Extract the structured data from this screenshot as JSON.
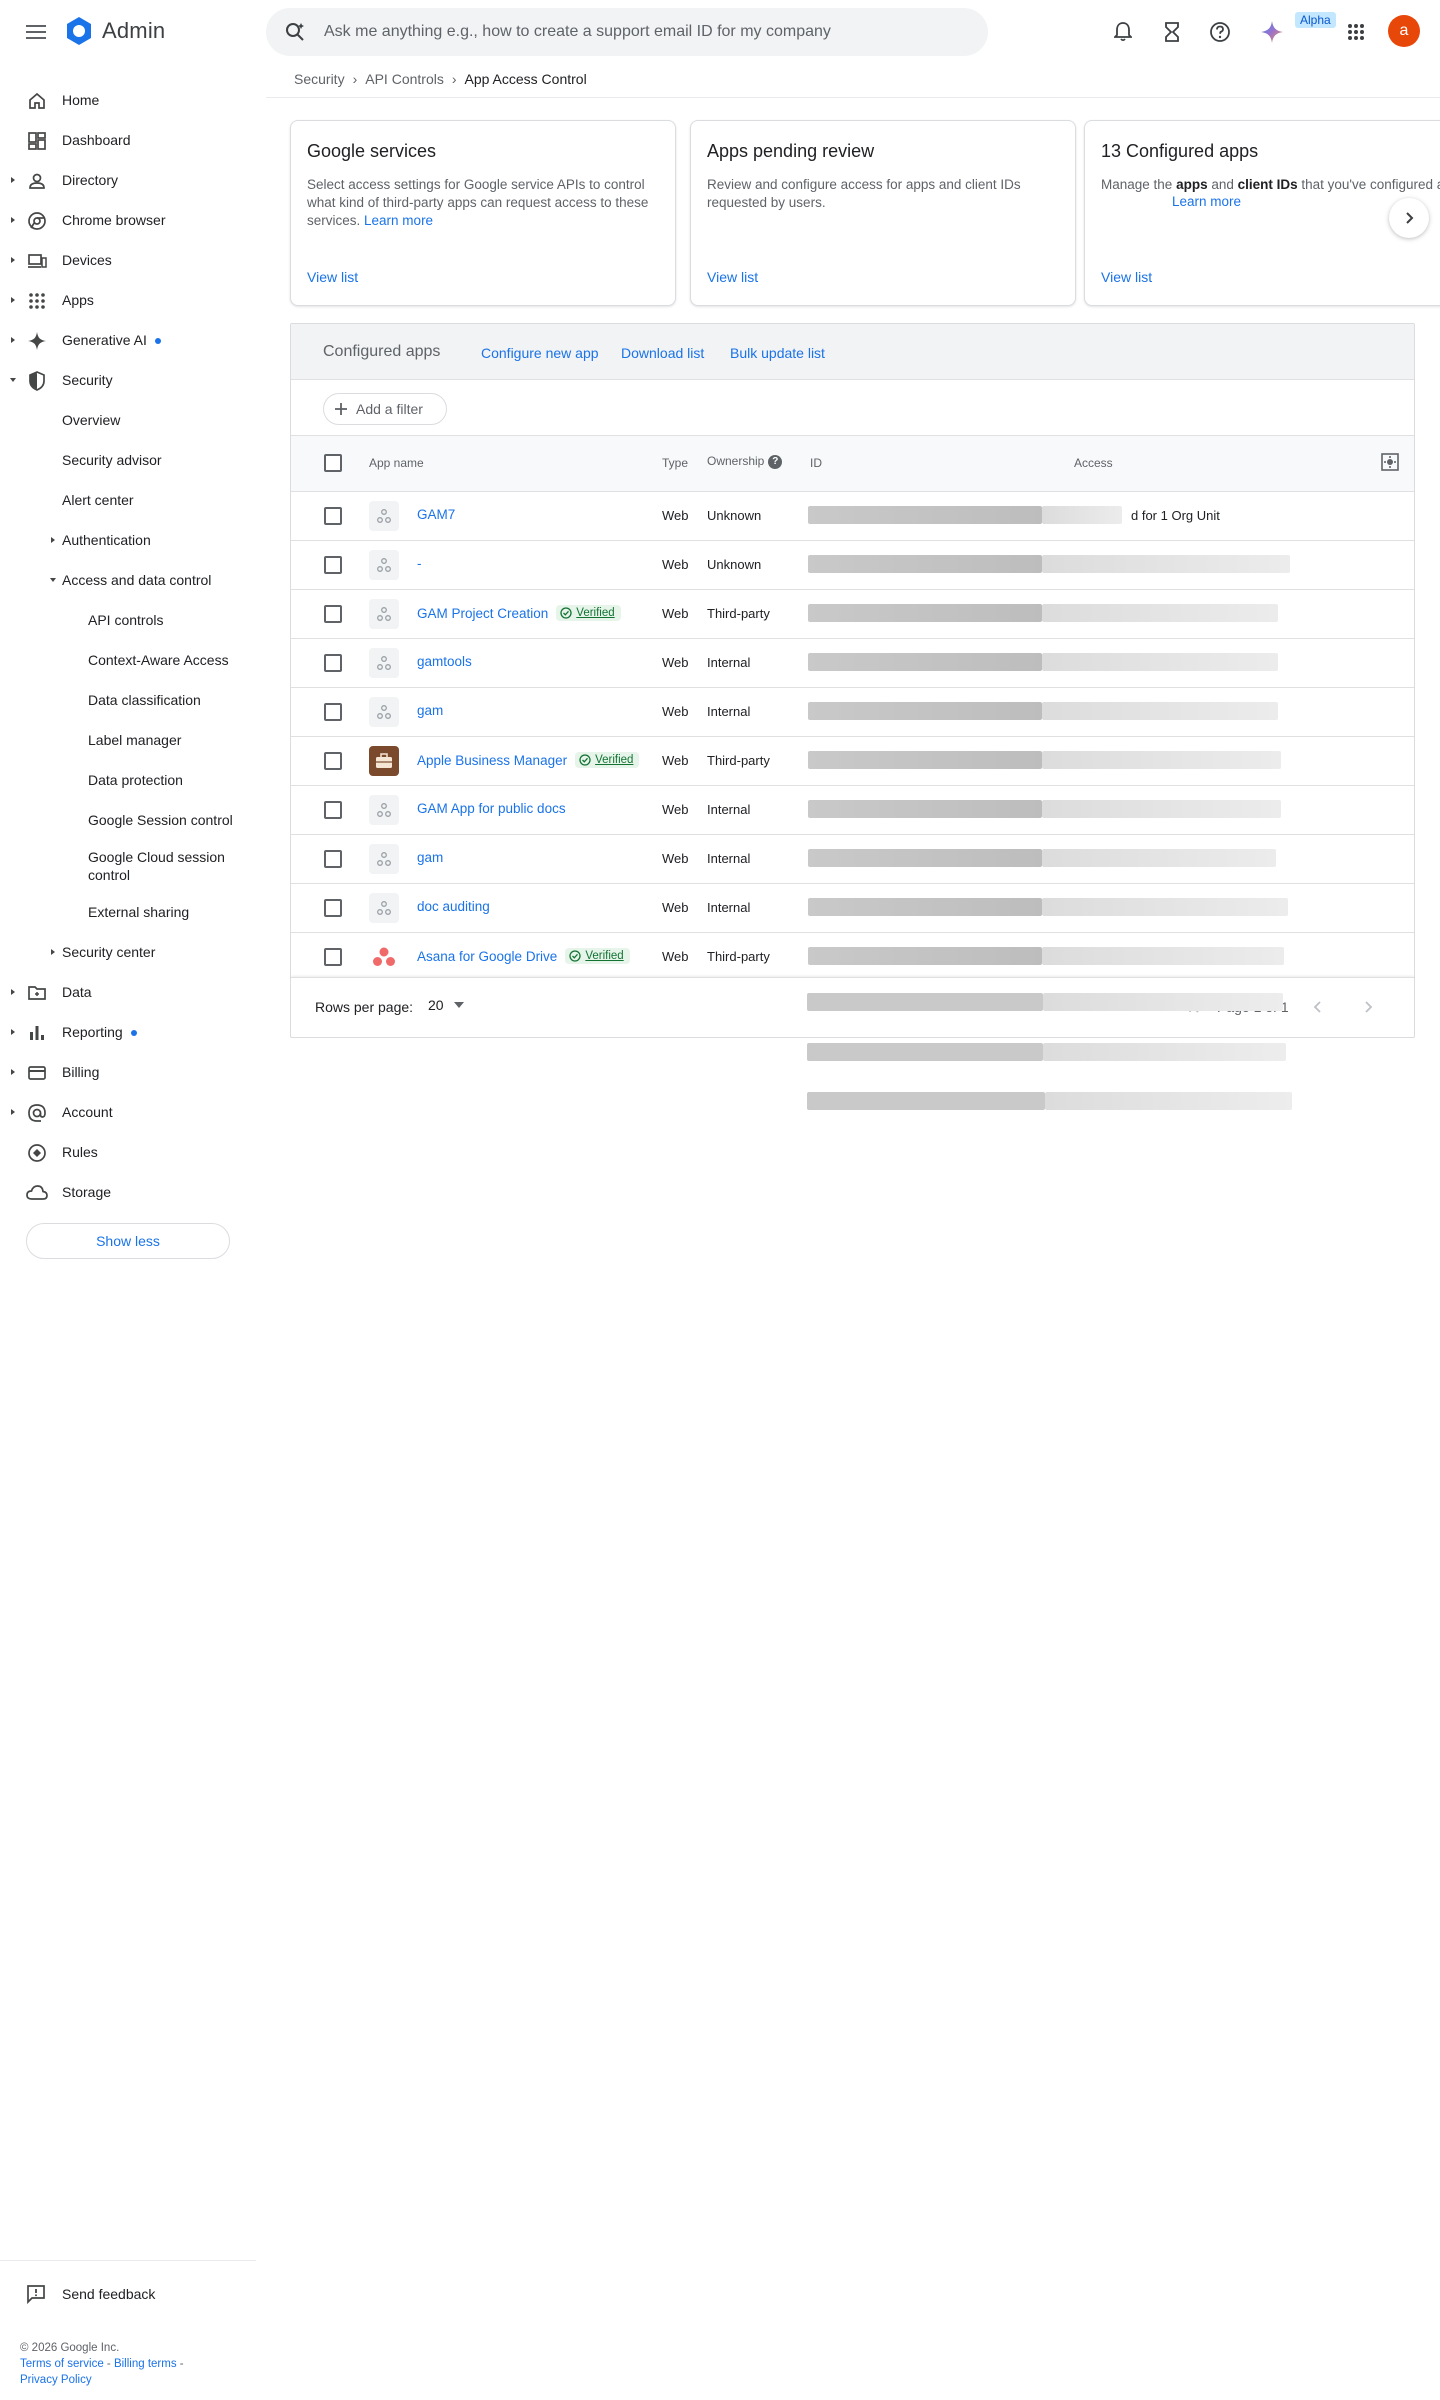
{
  "app": {
    "title": "Admin",
    "search_placeholder": "Ask me anything e.g., how to create a support email ID for my company",
    "alpha_badge": "Alpha",
    "avatar_initial": "a",
    "avatar_color": "#e8470a",
    "accent_color": "#1a73e8"
  },
  "breadcrumb": {
    "items": [
      "Security",
      "API Controls"
    ],
    "current": "App Access Control",
    "separator": "›"
  },
  "sidebar": {
    "items": [
      {
        "label": "Home",
        "icon": "home-icon"
      },
      {
        "label": "Dashboard",
        "icon": "dashboard-icon"
      },
      {
        "label": "Directory",
        "icon": "person-icon"
      },
      {
        "label": "Chrome browser",
        "icon": "chrome-icon"
      },
      {
        "label": "Devices",
        "icon": "devices-icon"
      },
      {
        "label": "Apps",
        "icon": "apps-grid-icon"
      },
      {
        "label": "Generative AI",
        "icon": "sparkle-icon"
      },
      {
        "label": "Security",
        "icon": "shield-icon"
      },
      {
        "label": "Overview"
      },
      {
        "label": "Security advisor"
      },
      {
        "label": "Alert center"
      },
      {
        "label": "Authentication"
      },
      {
        "label": "Access and data control"
      },
      {
        "label": "API controls"
      },
      {
        "label": "Context-Aware Access"
      },
      {
        "label": "Data classification"
      },
      {
        "label": "Label manager"
      },
      {
        "label": "Data protection"
      },
      {
        "label": "Google Session control"
      },
      {
        "label": "Google Cloud session control"
      },
      {
        "label": "External sharing"
      },
      {
        "label": "Security center"
      },
      {
        "label": "Data",
        "icon": "folder-icon"
      },
      {
        "label": "Reporting",
        "icon": "bar-chart-icon"
      },
      {
        "label": "Billing",
        "icon": "credit-card-icon"
      },
      {
        "label": "Account",
        "icon": "at-sign-icon"
      },
      {
        "label": "Rules",
        "icon": "rules-icon"
      },
      {
        "label": "Storage",
        "icon": "cloud-icon"
      }
    ],
    "show_less": "Show less",
    "send_feedback": "Send feedback",
    "footer": {
      "copyright": "© 2026 Google Inc.",
      "terms": "Terms of service",
      "billing_terms": "Billing terms",
      "privacy": "Privacy Policy",
      "separator": " - "
    }
  },
  "cards": [
    {
      "title": "Google services",
      "desc": "Select access settings for Google service APIs to control what kind of third-party apps can request access to these services.",
      "learn_more": "Learn more",
      "view": "View list"
    },
    {
      "title": "Apps pending review",
      "desc": "Review and configure access for apps and client IDs requested by users.",
      "view": "View list"
    },
    {
      "title": "13 Configured apps",
      "desc_prefix": "Manage the ",
      "desc_bold1": "apps",
      "desc_mid": " and ",
      "desc_bold2": "client IDs",
      "desc_suffix": " that you've configured access for.",
      "learn_more": "Learn more",
      "view": "View list"
    }
  ],
  "panel": {
    "title": "Configured apps",
    "links": [
      "Configure new app",
      "Download list",
      "Bulk update list"
    ],
    "add_filter": "Add a filter",
    "columns": {
      "app_name": "App name",
      "type": "Type",
      "ownership": "Ownership",
      "id": "ID",
      "access": "Access"
    },
    "rows": [
      {
        "name": "GAM7",
        "verified": false,
        "icon": "generic",
        "type": "Web",
        "ownership": "Unknown",
        "access": "d for 1 Org Unit"
      },
      {
        "name": "-",
        "verified": false,
        "icon": "generic",
        "type": "Web",
        "ownership": "Unknown",
        "access": ""
      },
      {
        "name": "GAM Project Creation",
        "verified": true,
        "icon": "generic",
        "type": "Web",
        "ownership": "Third-party",
        "access": ""
      },
      {
        "name": "gamtools",
        "verified": false,
        "icon": "generic",
        "type": "Web",
        "ownership": "Internal",
        "access": ""
      },
      {
        "name": "gam",
        "verified": false,
        "icon": "generic",
        "type": "Web",
        "ownership": "Internal",
        "access": ""
      },
      {
        "name": "Apple Business Manager",
        "verified": true,
        "icon": "briefcase",
        "type": "Web",
        "ownership": "Third-party",
        "access": ""
      },
      {
        "name": "GAM App for public docs",
        "verified": false,
        "icon": "generic",
        "type": "Web",
        "ownership": "Internal",
        "access": ""
      },
      {
        "name": "gam",
        "verified": false,
        "icon": "generic",
        "type": "Web",
        "ownership": "Internal",
        "access": ""
      },
      {
        "name": "doc auditing",
        "verified": false,
        "icon": "generic",
        "type": "Web",
        "ownership": "Internal",
        "access": ""
      },
      {
        "name": "Asana for Google Drive",
        "verified": true,
        "icon": "asana",
        "type": "Web",
        "ownership": "Third-party",
        "access": ""
      }
    ],
    "verified_label": "Verified",
    "rows_per_page_label": "Rows per page:",
    "rows_per_page_value": "20",
    "pager_text": "Page 1 of 1"
  }
}
